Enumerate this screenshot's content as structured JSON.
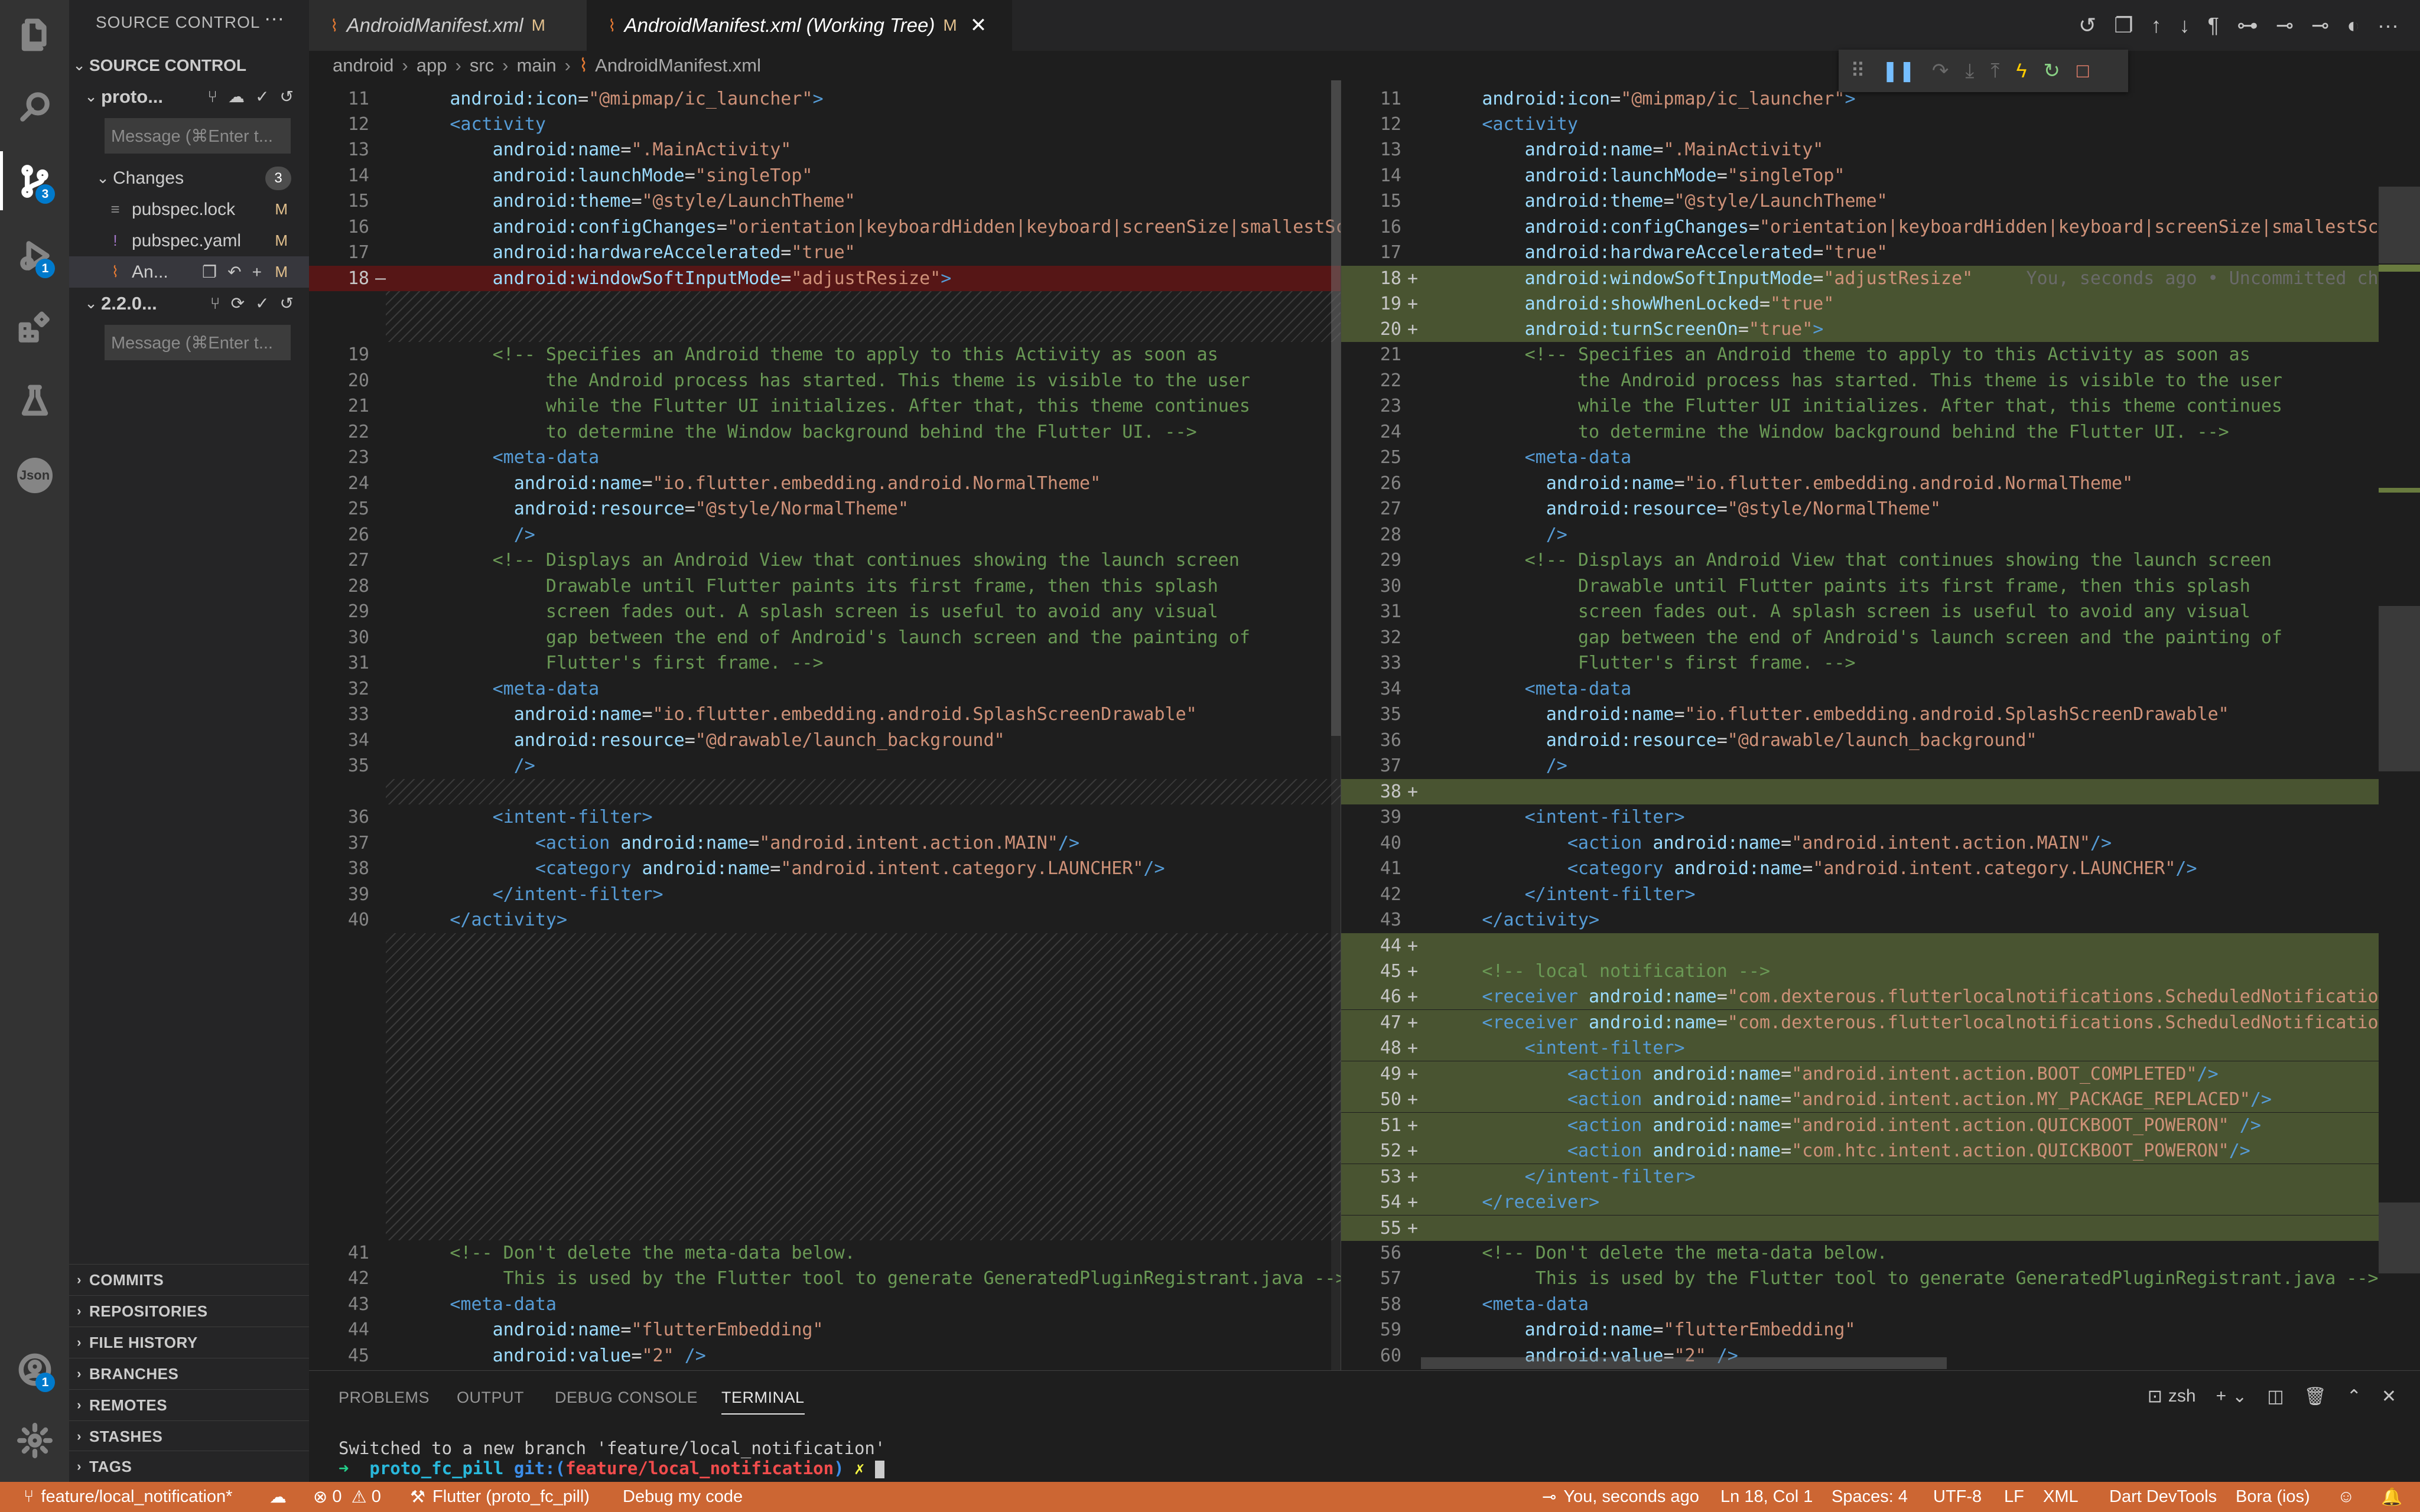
{
  "activity": {
    "scm_badge": "3",
    "debug_badge": "1",
    "account_badge": "1",
    "json_label": "Json"
  },
  "sidebar": {
    "title": "SOURCE CONTROL",
    "more": "···",
    "section_title": "SOURCE CONTROL",
    "repo1_name": "proto...",
    "repo1_message_placeholder": "Message (⌘Enter t...",
    "changes_label": "Changes",
    "changes_count": "3",
    "files": [
      {
        "name": "pubspec.lock",
        "status": "M"
      },
      {
        "name": "pubspec.yaml",
        "status": "M"
      },
      {
        "name": "An...",
        "status": "M"
      }
    ],
    "repo2_name": "2.2.0...",
    "repo2_message_placeholder": "Message (⌘Enter t...",
    "sections": [
      "COMMITS",
      "REPOSITORIES",
      "FILE HISTORY",
      "BRANCHES",
      "REMOTES",
      "STASHES",
      "TAGS"
    ]
  },
  "tabs": [
    {
      "label": "AndroidManifest.xml",
      "status": "M"
    },
    {
      "label": "AndroidManifest.xml (Working Tree)",
      "status": "M"
    }
  ],
  "breadcrumb": [
    "android",
    "app",
    "src",
    "main",
    "AndroidManifest.xml"
  ],
  "blame_hint": "You, seconds ago • Uncommitted ch",
  "panel": {
    "tabs": [
      "PROBLEMS",
      "OUTPUT",
      "DEBUG CONSOLE",
      "TERMINAL"
    ],
    "shell": "zsh",
    "terminal_line1": "Switched to a new branch 'feature/local_notification'",
    "prompt_arrow": "➜",
    "prompt_dir": "proto_fc_pill",
    "prompt_git": "git:(",
    "prompt_branch": "feature/local_notification",
    "prompt_git_close": ")",
    "prompt_x": "✗"
  },
  "status": {
    "branch": "feature/local_notification*",
    "errors": "0",
    "warnings": "0",
    "flutter": "Flutter (proto_fc_pill)",
    "debug": "Debug my code",
    "blame": "You, seconds ago",
    "position": "Ln 18, Col 1",
    "spaces": "Spaces: 4",
    "encoding": "UTF-8",
    "eol": "LF",
    "language": "XML",
    "devtools": "Dart DevTools",
    "device": "Bora (ios)"
  },
  "colors": {
    "statusbar": "#cc6633",
    "added": "#9bb955",
    "removed": "#ff0000",
    "accent_badge": "#007acc"
  }
}
